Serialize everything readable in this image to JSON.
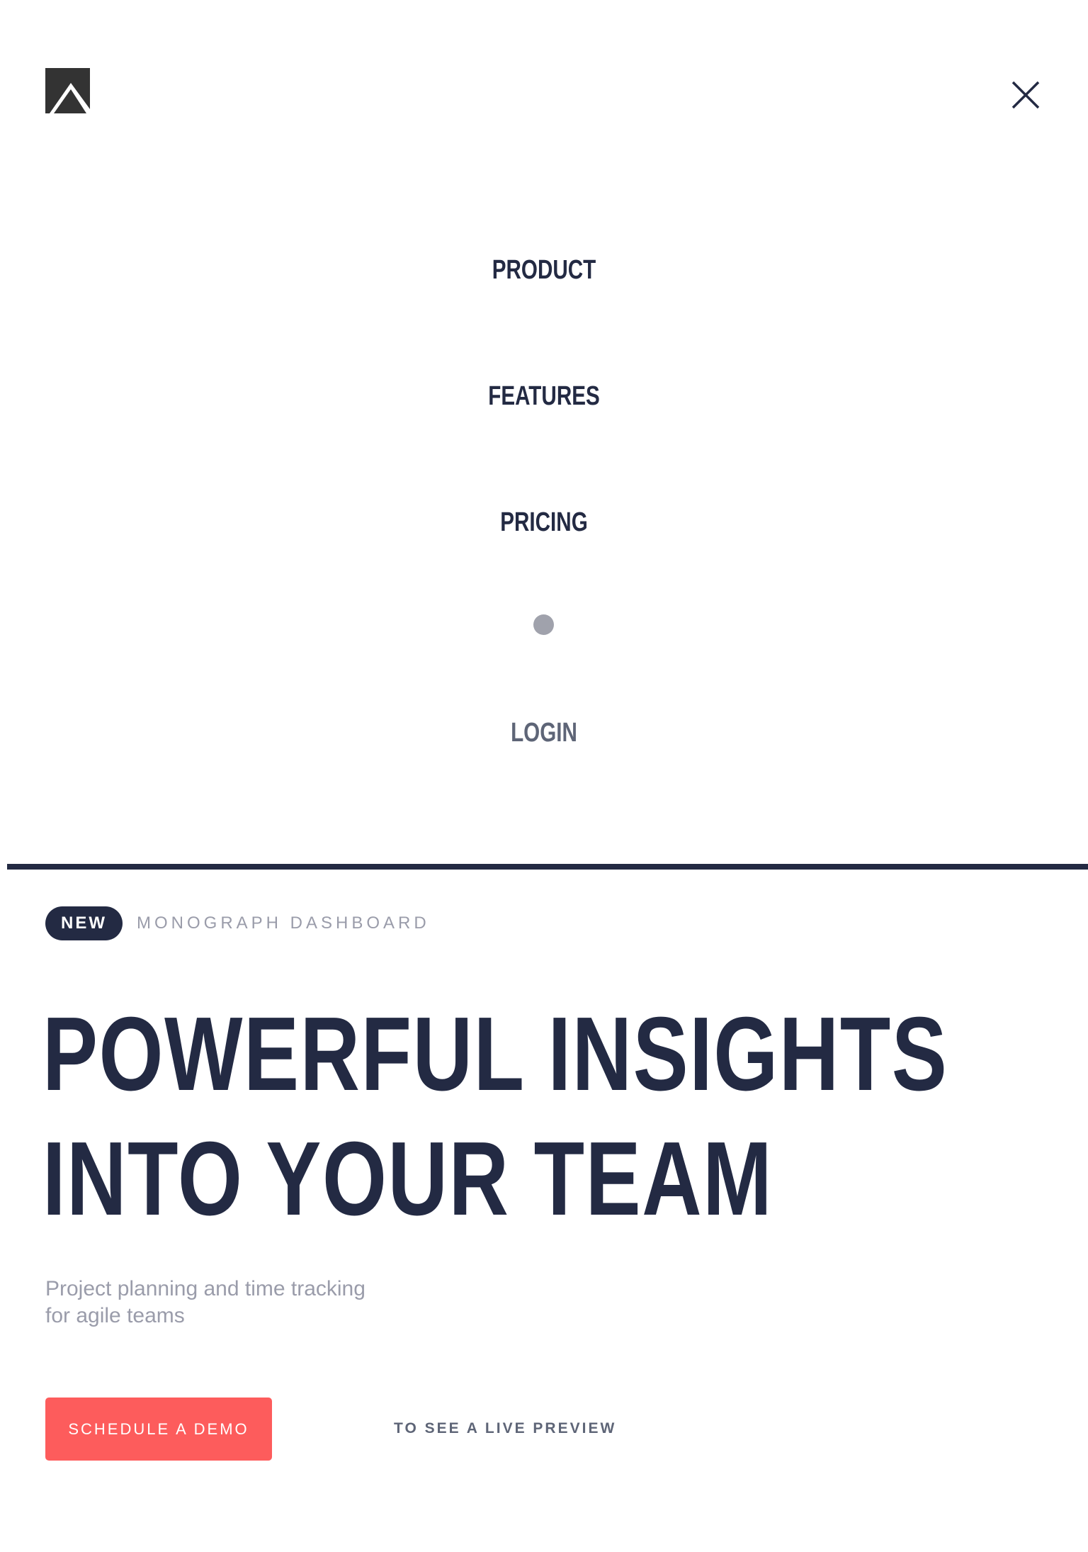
{
  "header": {
    "logo_icon": "monograph-k-logo-icon",
    "close_icon": "close-icon"
  },
  "menu": {
    "items": [
      {
        "label": "PRODUCT"
      },
      {
        "label": "FEATURES"
      },
      {
        "label": "PRICING"
      }
    ],
    "separator_icon": "dot-separator-icon",
    "login_label": "LOGIN"
  },
  "hero": {
    "badge": "NEW",
    "badge_label": "MONOGRAPH DASHBOARD",
    "headline_lines": [
      "POWERFUL INSIGHTS",
      "INTO YOUR TEAM"
    ],
    "subtitle_lines": [
      "Project planning and time tracking",
      "for agile teams"
    ],
    "cta_button": "SCHEDULE A DEMO",
    "cta_link": "TO SEE A LIVE PREVIEW"
  },
  "colors": {
    "navy": "#232a43",
    "muted_text": "#9a9caa",
    "login_text": "#5e6577",
    "dot": "#a0a2ac",
    "cta_background": "#fd5c5c",
    "background": "#ffffff"
  }
}
